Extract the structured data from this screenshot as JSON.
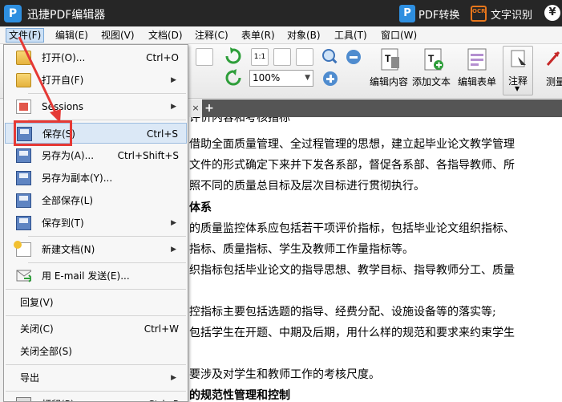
{
  "app": {
    "title": "迅捷PDF编辑器",
    "logo": "P"
  },
  "titlebar": {
    "pdf_convert": "PDF转换",
    "pdf_convert_icon": "P",
    "ocr": "文字识别",
    "ocr_icon": "OCR",
    "yen": "¥"
  },
  "menubar": [
    "文件(F)",
    "编辑(E)",
    "视图(V)",
    "文档(D)",
    "注释(C)",
    "表单(R)",
    "对象(B)",
    "工具(T)",
    "窗口(W)"
  ],
  "toolbar": {
    "zoom": "100%",
    "zoom_actual": "1:1",
    "edit_content": "编辑内容",
    "add_text": "添加文本",
    "edit_form": "编辑表单",
    "annotate": "注释",
    "measure": "测量"
  },
  "tabbar": {
    "close": "×",
    "add": "+"
  },
  "file_menu": {
    "items": [
      {
        "label": "打开(O)...",
        "shortcut": "Ctrl+O",
        "submenu": false
      },
      {
        "label": "打开自(F)",
        "shortcut": "",
        "submenu": true
      },
      {
        "label": "Sessions",
        "shortcut": "",
        "submenu": true
      },
      {
        "label": "保存(S)",
        "shortcut": "Ctrl+S",
        "submenu": false
      },
      {
        "label": "另存为(A)...",
        "shortcut": "Ctrl+Shift+S",
        "submenu": false
      },
      {
        "label": "另存为副本(Y)...",
        "shortcut": "",
        "submenu": false
      },
      {
        "label": "全部保存(L)",
        "shortcut": "",
        "submenu": false
      },
      {
        "label": "保存到(T)",
        "shortcut": "",
        "submenu": true
      },
      {
        "label": "新建文档(N)",
        "shortcut": "",
        "submenu": true
      },
      {
        "label": "用 E-mail 发送(E)...",
        "shortcut": "",
        "submenu": false
      },
      {
        "label": "回复(V)",
        "shortcut": "",
        "submenu": false
      },
      {
        "label": "关闭(C)",
        "shortcut": "Ctrl+W",
        "submenu": false
      },
      {
        "label": "关闭全部(S)",
        "shortcut": "",
        "submenu": false
      },
      {
        "label": "导出",
        "shortcut": "",
        "submenu": true
      },
      {
        "label": "打印(P)...",
        "shortcut": "Ctrl+P",
        "submenu": false
      }
    ],
    "submenu_arrow": "▶"
  },
  "document": {
    "lines": [
      "评价内容和考核指标",
      "借助全面质量管理、全过程管理的思想，建立起毕业论文教学管理",
      "文件的形式确定下来并下发各系部，督促各系部、各指导教师、所",
      "照不同的质量总目标及层次目标进行贯彻执行。",
      "体系",
      "的质量监控体系应包括若干项评价指标，包括毕业论文组织指标、",
      "指标、质量指标、学生及教师工作量指标等。",
      "织指标包括毕业论文的指导思想、教学目标、指导教师分工、质量",
      "",
      "控指标主要包括选题的指导、经费分配、设施设备等的落实等;",
      "包括学生在开题、中期及后期，用什么样的规范和要求来约束学生",
      "",
      "要涉及对学生和教师工作的考核尺度。",
      "的规范性管理和控制"
    ]
  },
  "colors": {
    "highlight": "#e53935",
    "titlebar_bg": "#262626",
    "brand_blue": "#2e8fe0",
    "ocr_orange": "#e8761b"
  }
}
